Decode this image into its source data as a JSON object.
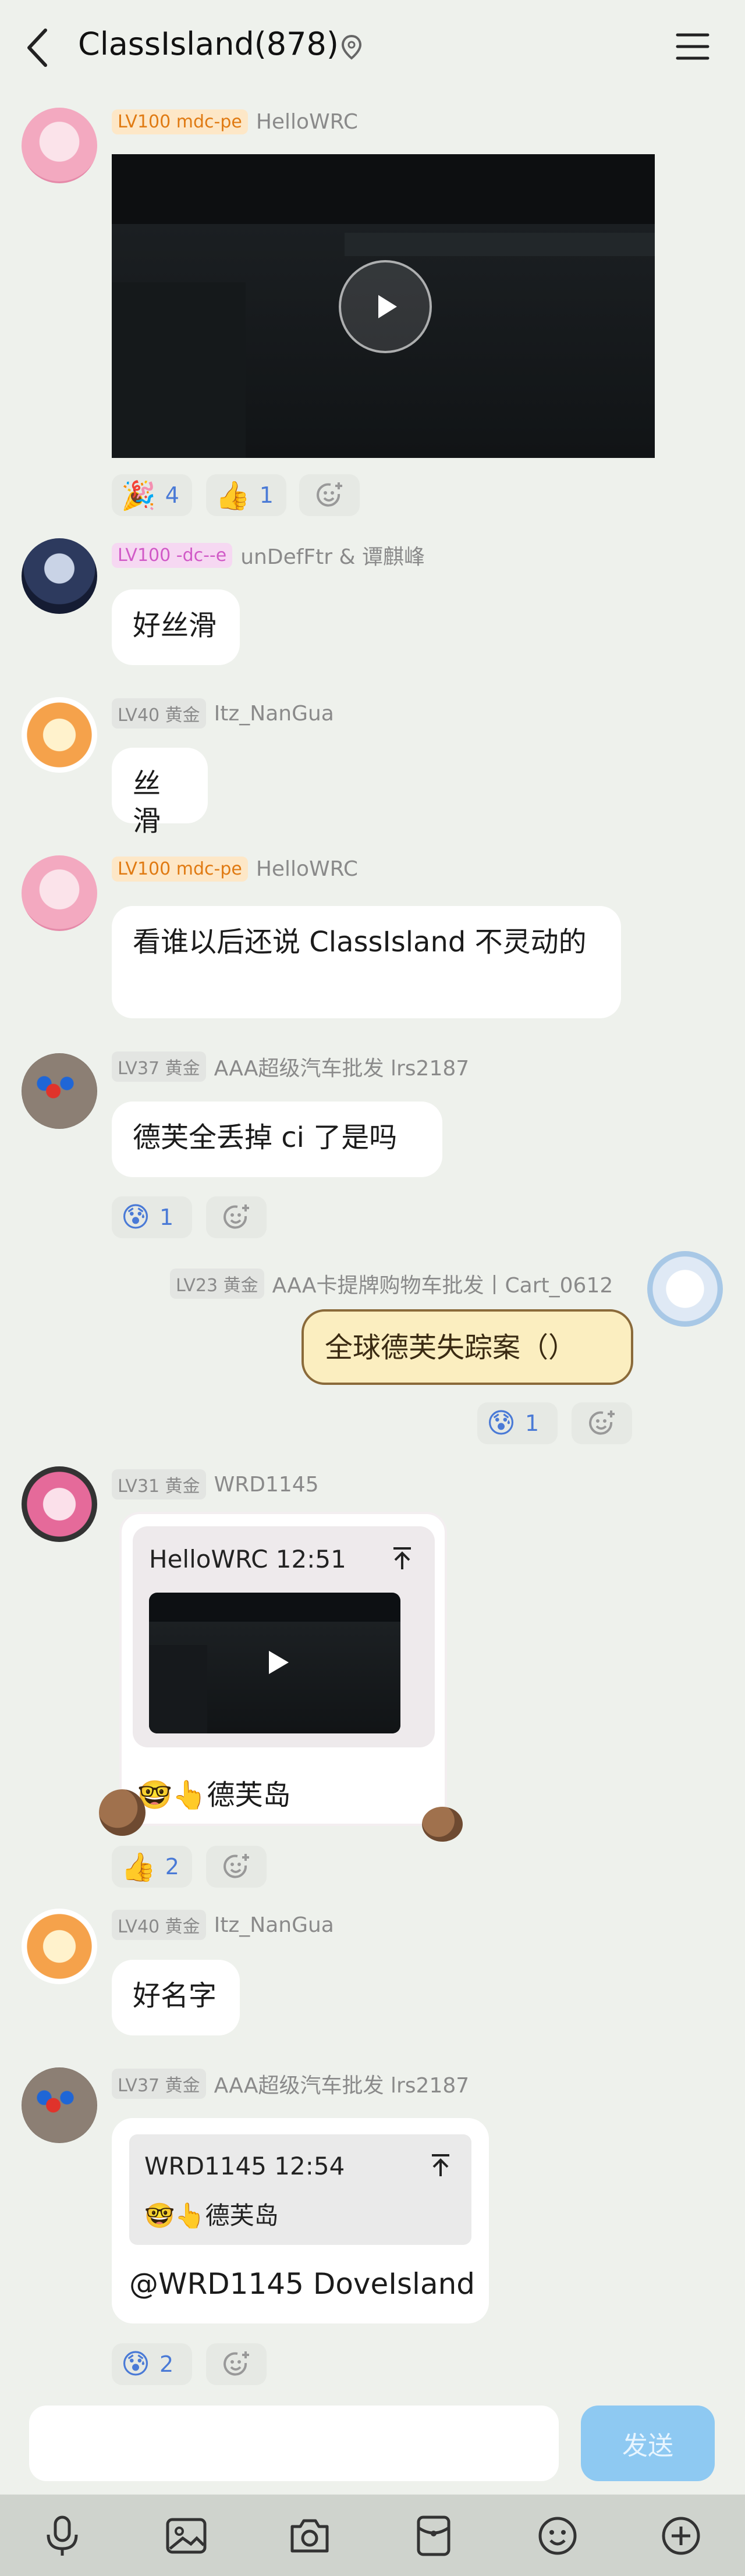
{
  "header": {
    "title": "ClassIsland(878)"
  },
  "messages": [
    {
      "badge": "LV100 mdc-pe",
      "name": "HelloWRC"
    },
    {
      "badge": "LV100 -dc--e",
      "name": "unDefFtr & 谭麒峰",
      "text": "好丝滑"
    },
    {
      "badge": "LV40 黄金",
      "name": "Itz_NanGua",
      "text": "丝滑"
    },
    {
      "badge": "LV100 mdc-pe",
      "name": "HelloWRC",
      "text": "看谁以后还说 ClassIsland 不灵动的"
    },
    {
      "badge": "LV37 黄金",
      "name": "AAA超级汽车批发 lrs2187",
      "text": "德芙全丢掉 ci 了是吗"
    },
    {
      "badge": "LV23 黄金",
      "name": "AAA卡提牌购物车批发丨Cart_0612",
      "text": "全球德芙失踪案（）"
    },
    {
      "badge": "LV31 黄金",
      "name": "WRD1145",
      "quote_header": "HelloWRC 12:51",
      "text": "🤓👆德芙岛"
    },
    {
      "badge": "LV40 黄金",
      "name": "Itz_NanGua",
      "text": "好名字"
    },
    {
      "badge": "LV37 黄金",
      "name": "AAA超级汽车批发 lrs2187",
      "quote_header": "WRD1145 12:54",
      "quote_text": "🤓👆德芙岛",
      "text": "@WRD1145 DoveIsland"
    }
  ],
  "reactions": {
    "r1a": {
      "emoji": "🎉",
      "count": "4"
    },
    "r1b": {
      "emoji": "👍",
      "count": "1"
    },
    "r5": {
      "emoji": "😰",
      "count": "1"
    },
    "r6": {
      "emoji": "😰",
      "count": "1"
    },
    "r7": {
      "emoji": "👍",
      "count": "2"
    },
    "r9": {
      "emoji": "😰",
      "count": "2"
    }
  },
  "input": {
    "send_label": "发送"
  },
  "colors": {
    "background": "#eef1ec",
    "send": "#8ec9f2",
    "reaction_count": "#4a7ad6"
  }
}
